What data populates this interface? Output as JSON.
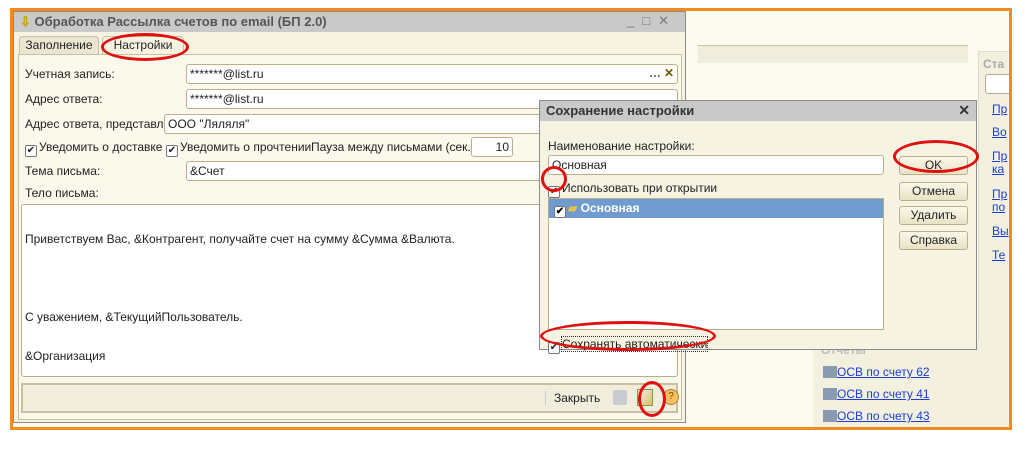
{
  "main_window": {
    "title": "Обработка  Рассылка счетов по email (БП 2.0)",
    "tabs": [
      {
        "label": "Заполнение"
      },
      {
        "label": "Настройки"
      }
    ],
    "fields": {
      "account_label": "Учетная запись:",
      "account_value": "*******@list.ru",
      "reply_label": "Адрес ответа:",
      "reply_value": "*******@list.ru",
      "reply_repr_label": "Адрес ответа, представление:",
      "reply_repr_value": "ООО \"Ляляля\"",
      "notify_delivery": "Уведомить о доставке",
      "notify_read": "Уведомить о прочтении",
      "pause_label": "Пауза между письмами (сек.):",
      "pause_value": "10",
      "subject_label": "Тема письма:",
      "subject_value": "&Счет",
      "body_label": "Тело письма:",
      "body_lines": [
        "Приветствуем Вас, &Контрагент, получайте счет на сумму &Сумма &Валюта.",
        "",
        "С уважением, &ТекущийПользователь.",
        "&Организация"
      ]
    },
    "footer": {
      "close_label": "Закрыть"
    }
  },
  "background": {
    "right_panel_header": "Ста",
    "right_links": [
      "Пр",
      "Во",
      "Пр",
      "ка",
      "Пр",
      "по",
      "Вы",
      "Те"
    ],
    "reports_header": "Отчеты",
    "reports": [
      "ОСВ по счету 62",
      "ОСВ по счету 41",
      "ОСВ по счету 43"
    ]
  },
  "dialog": {
    "title": "Сохранение настройки",
    "name_label": "Наименование настройки:",
    "name_value": "Основная",
    "use_on_open": "Использовать при открытии",
    "list_items": [
      "Основная"
    ],
    "auto_save": "Сохранять автоматически",
    "buttons": {
      "ok": "OK",
      "cancel": "Отмена",
      "delete": "Удалить",
      "help": "Справка"
    }
  },
  "colors": {
    "highlight": "#e01010",
    "frame": "#f58a1f",
    "selection": "#6f9bd0"
  }
}
